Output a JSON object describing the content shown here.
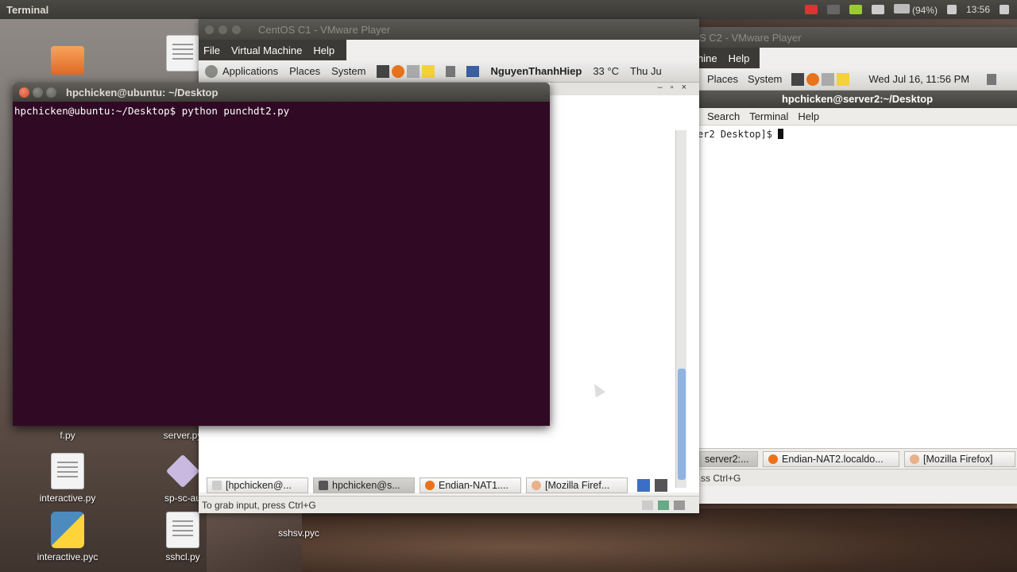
{
  "top_panel": {
    "app_title": "Terminal",
    "battery": "(94%)",
    "time": "13:56"
  },
  "desktop": {
    "icons": [
      {
        "label": "f.py"
      },
      {
        "label": "server.py"
      },
      {
        "label": "interactive.py"
      },
      {
        "label": "sp-sc-au"
      },
      {
        "label": "interactive.pyc"
      },
      {
        "label": "sshcl.py"
      },
      {
        "label": "sshsv.pyc"
      }
    ]
  },
  "vm1": {
    "title": "CentOS C1 - VMware Player",
    "menu": [
      "File",
      "Virtual Machine",
      "Help"
    ],
    "guest_panel": {
      "apps": "Applications",
      "places": "Places",
      "system": "System",
      "user": "NguyenThanhHiep",
      "weather": "33 °C",
      "date": "Thu Ju"
    },
    "taskbar": [
      "[hpchicken@...",
      "hpchicken@s...",
      "Endian-NAT1....",
      "[Mozilla Firef..."
    ],
    "status": "To grab input, press Ctrl+G"
  },
  "vm2": {
    "title": "S C2 - VMware Player",
    "menu": [
      "hine",
      "Help"
    ],
    "guest_panel": {
      "places": "Places",
      "system": "System",
      "date": "Wed Jul 16, 11:56 PM"
    },
    "term_title": "hpchicken@server2:~/Desktop",
    "term_menu": [
      "Search",
      "Terminal",
      "Help"
    ],
    "prompt": "er2 Desktop]$ ",
    "taskbar": [
      "server2:...",
      "Endian-NAT2.localdo...",
      "[Mozilla Firefox]"
    ],
    "status": "ss Ctrl+G"
  },
  "terminal": {
    "title": "hpchicken@ubuntu: ~/Desktop",
    "line": "hpchicken@ubuntu:~/Desktop$ python punchdt2.py"
  },
  "colors": {
    "terminal_bg": "#300a24",
    "ubuntu_close": "#d2452a",
    "selection_blue": "#8fb4e3"
  }
}
